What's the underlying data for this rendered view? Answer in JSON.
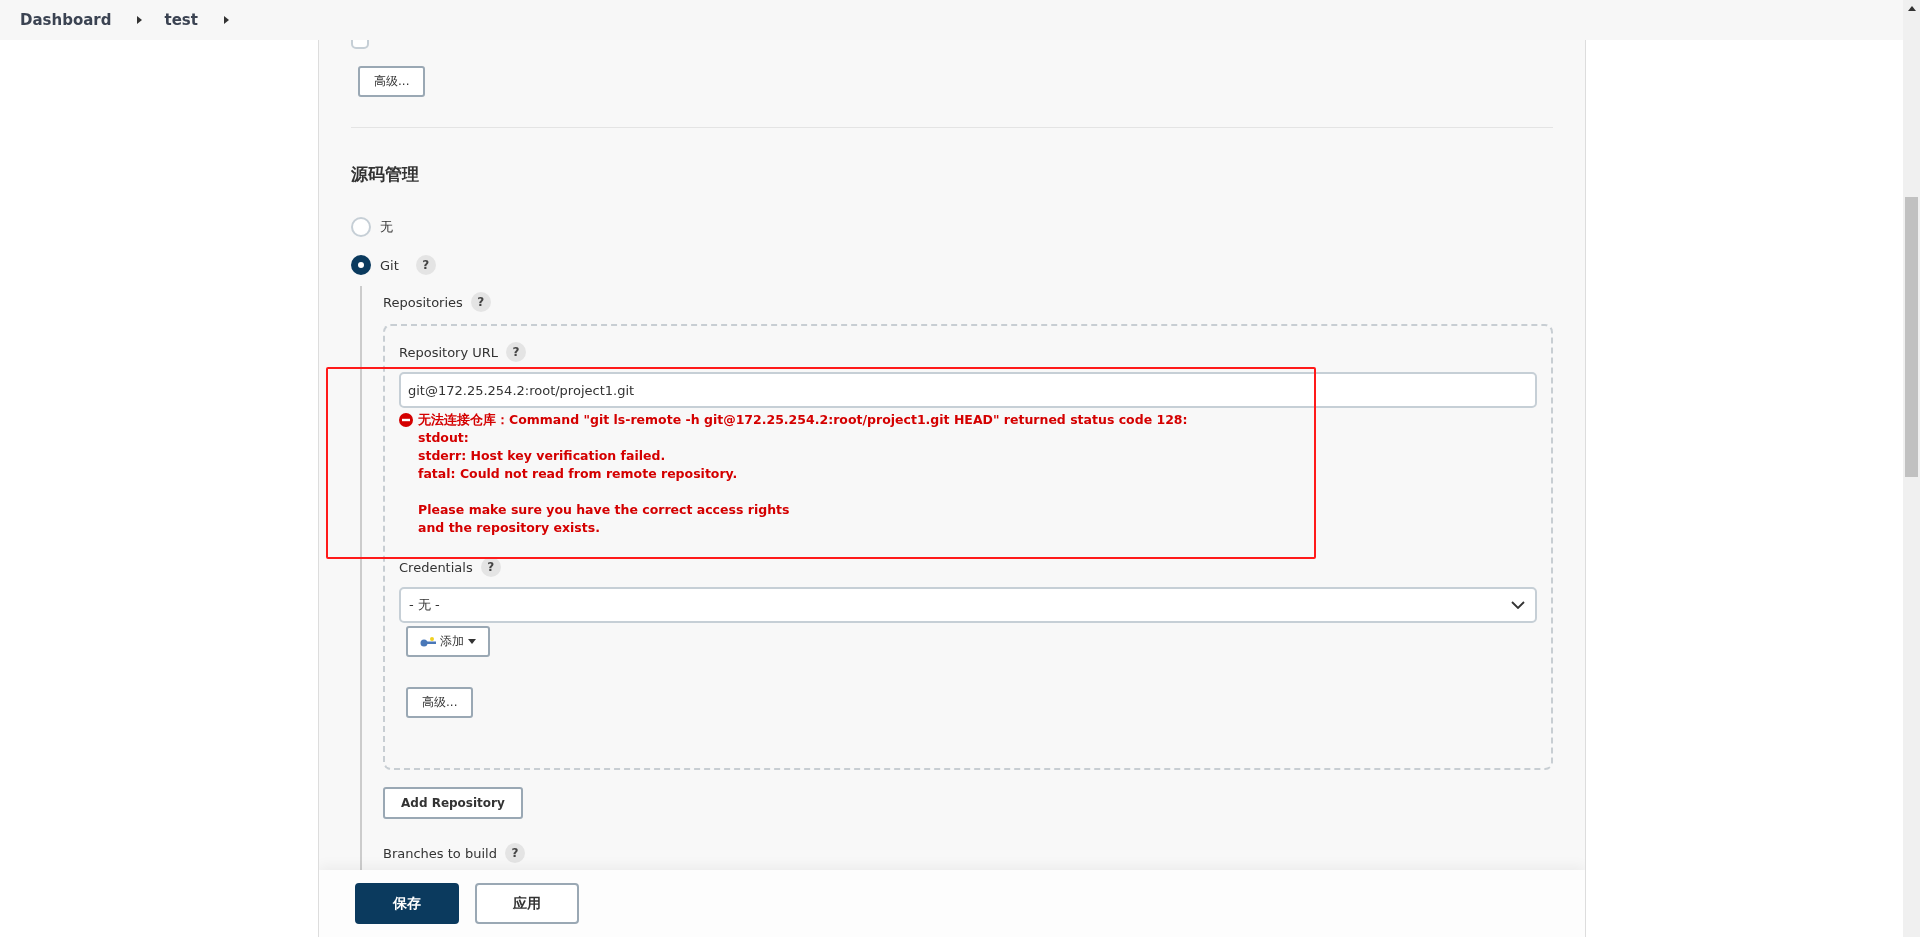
{
  "breadcrumbs": [
    {
      "label": "Dashboard"
    },
    {
      "label": "test"
    }
  ],
  "concurrent_build": {
    "checked": false
  },
  "advanced_button_top": "高级...",
  "section_title": "源码管理",
  "scm_options": [
    {
      "label": "无",
      "selected": false
    },
    {
      "label": "Git",
      "selected": true,
      "help": "?"
    }
  ],
  "repositories": {
    "label": "Repositories",
    "help": "?",
    "url": {
      "label": "Repository URL",
      "help": "?",
      "value": "git@172.25.254.2:root/project1.git",
      "error": {
        "title": "无法连接仓库：Command \"git ls-remote -h git@172.25.254.2:root/project1.git HEAD\" returned status code 128:",
        "details": [
          "stdout:",
          "stderr: Host key verification failed.",
          "fatal: Could not read from remote repository."
        ],
        "hint": [
          "Please make sure you have the correct access rights",
          "and the repository exists."
        ]
      }
    },
    "credentials": {
      "label": "Credentials",
      "help": "?",
      "value": "- 无 -",
      "add_button": "添加",
      "advanced_button": "高级..."
    }
  },
  "add_repository_button": "Add Repository",
  "branches": {
    "label": "Branches to build",
    "help": "?"
  },
  "footer": {
    "buttons": [
      {
        "label": "保存",
        "kind": "primary"
      },
      {
        "label": "应用",
        "kind": "secondary"
      }
    ]
  }
}
